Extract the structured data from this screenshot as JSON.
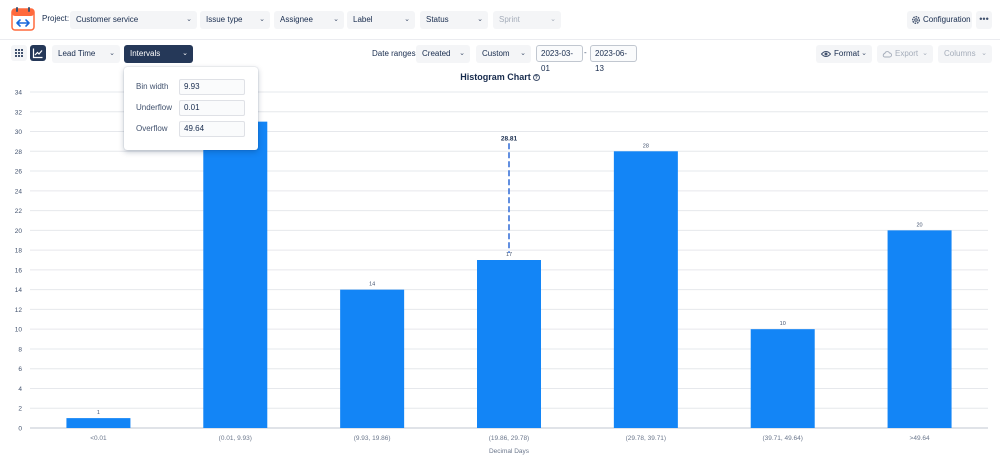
{
  "header": {
    "project_label": "Project:",
    "filters": [
      {
        "label": "Customer service"
      },
      {
        "label": "Issue type"
      },
      {
        "label": "Assignee"
      },
      {
        "label": "Label"
      },
      {
        "label": "Status"
      },
      {
        "label": "Sprint",
        "disabled": true
      }
    ],
    "configuration_label": "Configuration",
    "more_label": "•••"
  },
  "toolbar": {
    "metric": "Lead Time",
    "intervals": "Intervals",
    "date_ranges_label": "Date ranges:",
    "date_field": "Created",
    "range_type": "Custom",
    "date_from": "2023-03-01",
    "date_sep": "-",
    "date_to": "2023-06-13",
    "format_label": "Format",
    "export_label": "Export",
    "columns_label": "Columns"
  },
  "popover": {
    "bin_width_label": "Bin width",
    "bin_width": "9.93",
    "underflow_label": "Underflow",
    "underflow": "0.01",
    "overflow_label": "Overflow",
    "overflow": "49.64"
  },
  "chart_data": {
    "type": "bar",
    "title": "Histogram Chart",
    "xlabel": "Decimal Days",
    "ylabel": "",
    "ylim": [
      0,
      34
    ],
    "yticks": [
      0,
      2,
      4,
      6,
      8,
      10,
      12,
      14,
      16,
      18,
      20,
      22,
      24,
      26,
      28,
      30,
      32,
      34
    ],
    "grid": true,
    "categories": [
      "<0.01",
      "(0.01, 9.93)",
      "(9.93, 19.86)",
      "(19.86, 29.78)",
      "(29.78, 39.71)",
      "(39.71, 49.64)",
      ">49.64"
    ],
    "values": [
      1,
      31,
      14,
      17,
      28,
      10,
      20
    ],
    "value_labels": [
      "1",
      "",
      "14",
      "17",
      "28",
      "10",
      "20"
    ],
    "marker": {
      "value": 28.81,
      "label": "28.81",
      "category_index": 3
    },
    "colors": {
      "bar": "#1385f6",
      "marker": "#3b73d9",
      "grid": "#e6e8ec"
    }
  }
}
